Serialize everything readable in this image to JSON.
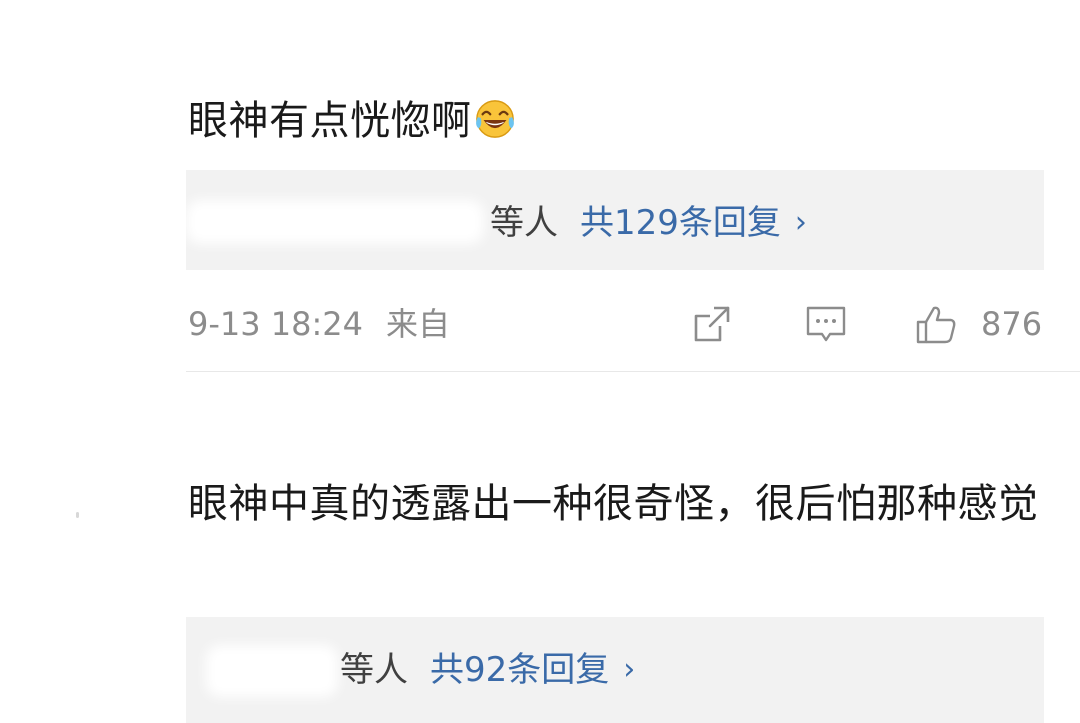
{
  "comments": [
    {
      "text": "眼神有点恍惚啊",
      "emoji": "laughing-tears-emoji",
      "reply": {
        "users_suffix": "等人",
        "count_label": "共129条回复",
        "chevron": "›"
      },
      "meta": {
        "time": "9-13 18:24",
        "source": "来自",
        "like_count": "876"
      }
    },
    {
      "text": "眼神中真的透露出一种很奇怪，很后怕那种感觉",
      "reply": {
        "users_suffix": "等人",
        "count_label": "共92条回复",
        "chevron": "›"
      }
    }
  ],
  "colors": {
    "link": "#3a6aa8",
    "meta": "#8c8c8c",
    "reply_bg": "#f2f2f2"
  },
  "icons": [
    "share-icon",
    "comment-icon",
    "like-icon"
  ]
}
